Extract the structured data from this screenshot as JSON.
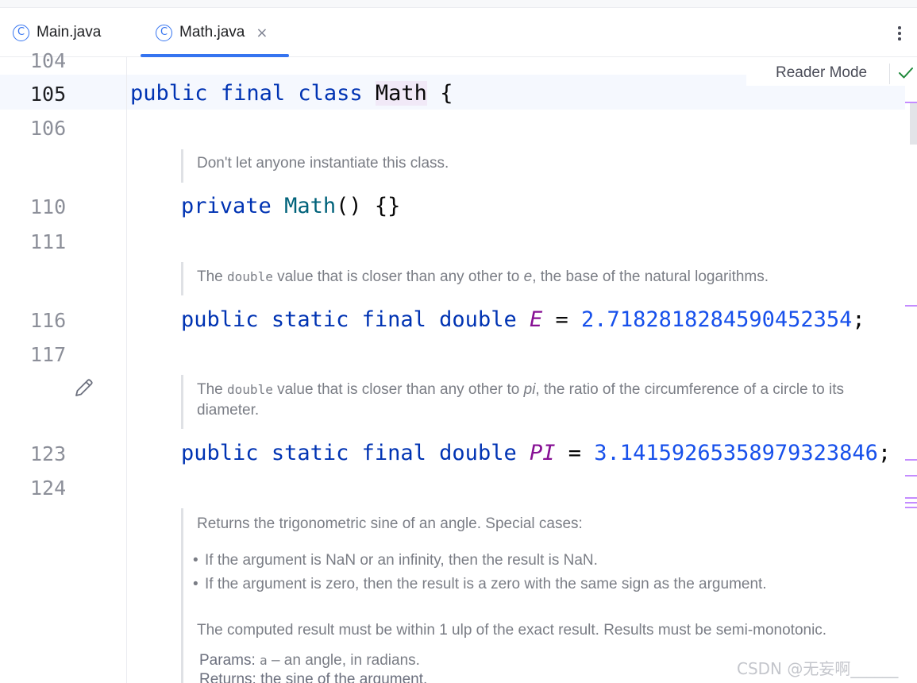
{
  "tabs": [
    {
      "label": "Main.java",
      "icon": "class-icon",
      "active": false
    },
    {
      "label": "Math.java",
      "icon": "class-icon",
      "active": true,
      "close": "×"
    }
  ],
  "tab_icon_glyph": "C",
  "reader_mode": {
    "label": "Reader Mode"
  },
  "line_numbers": [
    "104",
    "105",
    "106",
    "110",
    "111",
    "116",
    "117",
    "123",
    "124"
  ],
  "code": {
    "class_decl": {
      "kw1": "public",
      "kw2": "final",
      "kw3": "class",
      "name": "Math",
      "brace": "{"
    },
    "ctor": {
      "kw": "private",
      "name": "Math",
      "rest": "() {}"
    },
    "e_field": {
      "kw1": "public",
      "kw2": "static",
      "kw3": "final",
      "kw4": "double",
      "name": "E",
      "eq": "=",
      "value": "2.7182818284590452354",
      "semi": ";"
    },
    "pi_field": {
      "kw1": "public",
      "kw2": "static",
      "kw3": "final",
      "kw4": "double",
      "name": "PI",
      "eq": "=",
      "value": "3.14159265358979323846",
      "semi": ";"
    }
  },
  "docs": {
    "ctor": "Don't let anyone instantiate this class.",
    "e": {
      "pre": "The ",
      "code": "double",
      "mid": " value that is closer than any other to ",
      "em": "e",
      "post": ", the base of the natural logarithms."
    },
    "pi": {
      "pre": "The ",
      "code": "double",
      "mid": " value that is closer than any other to ",
      "em": "pi",
      "post": ", the ratio of the circumference of a circle to its diameter."
    },
    "sin": {
      "intro": "Returns the trigonometric sine of an angle. Special cases:",
      "bullets": [
        "If the argument is NaN or an infinity, then the result is NaN.",
        "If the argument is zero, then the result is a zero with the same sign as the argument."
      ],
      "note": "The computed result must be within 1 ulp of the exact result. Results must be semi-monotonic.",
      "params_label": "Params:",
      "params_code": "a",
      "params_text": " – an angle, in radians.",
      "returns_partial": "Returns:  the sine of the argument."
    }
  },
  "watermark": "CSDN @无妄啊______",
  "colors": {
    "accent": "#3574f0",
    "keyword": "#0033b3",
    "constant": "#871094",
    "number": "#1750eb",
    "function": "#00627a",
    "check": "#208a3c",
    "marker": "#c48cff"
  }
}
